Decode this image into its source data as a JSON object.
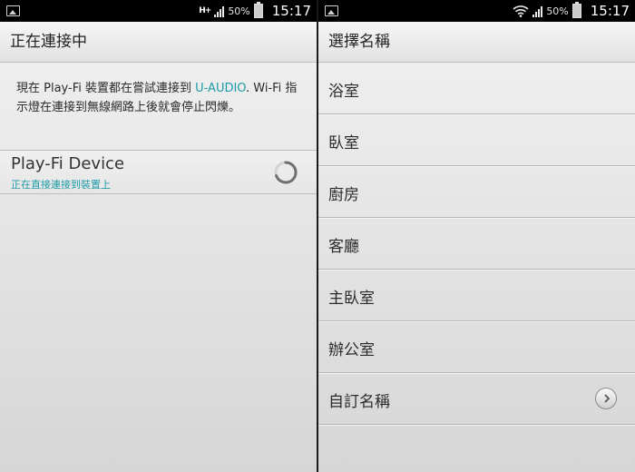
{
  "left": {
    "status": {
      "battery_pct": "50%",
      "time": "15:17",
      "network": "H+"
    },
    "title": "正在連接中",
    "message": {
      "part1": "現在 Play-Fi 裝置都在嘗試連接到 ",
      "network_name": "U-AUDIO",
      "part2": ". Wi-Fi 指示燈在連接到無線網路上後就會停止閃爍。"
    },
    "device": {
      "name": "Play-Fi Device",
      "status": "正在直接連接到裝置上"
    }
  },
  "right": {
    "status": {
      "battery_pct": "50%",
      "time": "15:17"
    },
    "title": "選擇名稱",
    "items": [
      {
        "label": "浴室"
      },
      {
        "label": "臥室"
      },
      {
        "label": "廚房"
      },
      {
        "label": "客廳"
      },
      {
        "label": "主臥室"
      },
      {
        "label": "辦公室"
      },
      {
        "label": "自訂名稱",
        "icon": "chevron-right-icon"
      }
    ]
  },
  "colors": {
    "accent": "#1f9ba8"
  }
}
